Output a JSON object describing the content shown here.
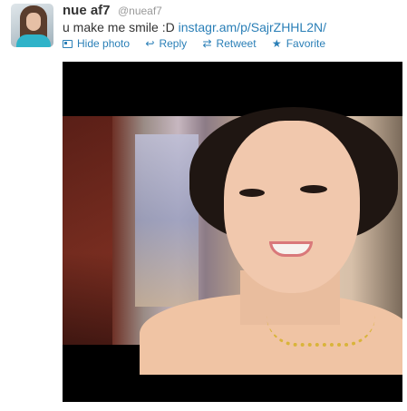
{
  "tweet": {
    "user_name": "nue af7",
    "handle": "@nueaf7",
    "text": "u make me smile :D ",
    "link": "instagr.am/p/SajrZHHL2N/"
  },
  "actions": {
    "hide_photo": "Hide photo",
    "reply": "Reply",
    "retweet": "Retweet",
    "favorite": "Favorite"
  },
  "icons": {
    "hide_photo": "photo-icon",
    "reply": "reply-arrow-icon",
    "retweet": "retweet-icon",
    "favorite": "star-icon"
  },
  "colors": {
    "link": "#2a7fb7",
    "name": "#333333",
    "handle": "#999999"
  }
}
